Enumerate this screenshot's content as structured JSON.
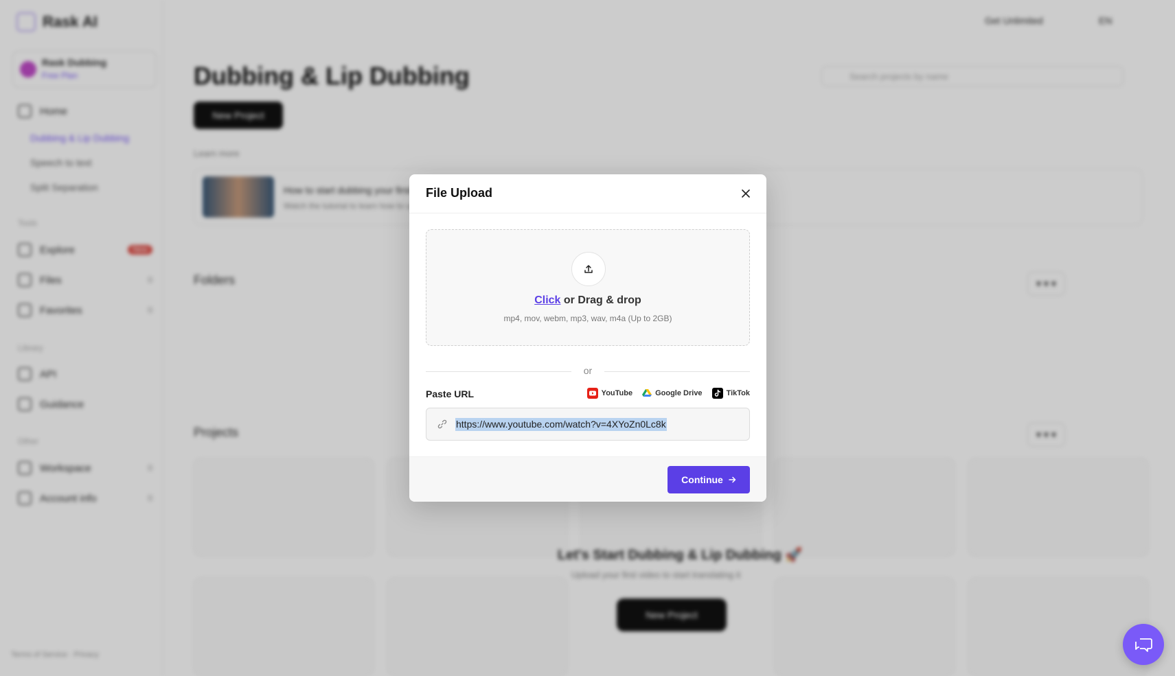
{
  "background": {
    "brand": "Rask AI",
    "workspace": {
      "name": "Rask Dubbing",
      "plan": "Free Plan"
    },
    "nav": [
      {
        "label": "Home",
        "icon": "home-icon"
      },
      {
        "label": "Explore",
        "icon": "compass-icon",
        "badge": "New"
      },
      {
        "label": "Files",
        "icon": "file-icon",
        "count": "0"
      },
      {
        "label": "Favorites",
        "icon": "star-icon",
        "count": "0"
      },
      {
        "label": "API",
        "icon": "code-icon"
      },
      {
        "label": "Guidance",
        "icon": "book-icon"
      },
      {
        "label": "Workspace",
        "icon": "users-icon",
        "count": "0"
      },
      {
        "label": "Account info",
        "icon": "user-icon",
        "count": "0"
      }
    ],
    "subnav": [
      "Dubbing & Lip Dubbing",
      "Speech to text",
      "Split Separation"
    ],
    "sections": [
      "Tools",
      "Library",
      "Other"
    ],
    "footer": "Terms of Service · Privacy",
    "top_links": [
      "Get Unlimited",
      "EN"
    ],
    "page_title": "Dubbing & Lip Dubbing",
    "new_button": "New Project",
    "search_placeholder": "Search projects by name",
    "learn_label": "Learn more",
    "banner_title": "How to start dubbing your first video",
    "banner_sub": "Watch the tutorial to learn how to upload files and choose your target language",
    "folders_label": "Folders",
    "projects_label": "Projects",
    "empty_title": "Let's Start Dubbing & Lip Dubbing 🚀",
    "empty_sub": "Upload your first video to start translating it",
    "empty_button": "New Project"
  },
  "modal": {
    "title": "File Upload",
    "close_icon": "close-icon",
    "upload_icon": "upload-icon",
    "click_label": "Click",
    "drop_label": " or Drag & drop",
    "formats": "mp4, mov, webm, mp3, wav, m4a (Up to 2GB)",
    "divider": "or",
    "url_label": "Paste URL",
    "sources": [
      {
        "name": "YouTube",
        "icon": "youtube-icon",
        "color": "#ff0000"
      },
      {
        "name": "Google Drive",
        "icon": "google-drive-icon",
        "color": "#1fa463"
      },
      {
        "name": "TikTok",
        "icon": "tiktok-icon",
        "color": "#000000"
      }
    ],
    "url_value": "https://www.youtube.com/watch?v=4XYoZn0Lc8k",
    "continue_label": "Continue",
    "accent": "#5b3fe6"
  },
  "chat": {
    "icon": "chat-icon"
  }
}
